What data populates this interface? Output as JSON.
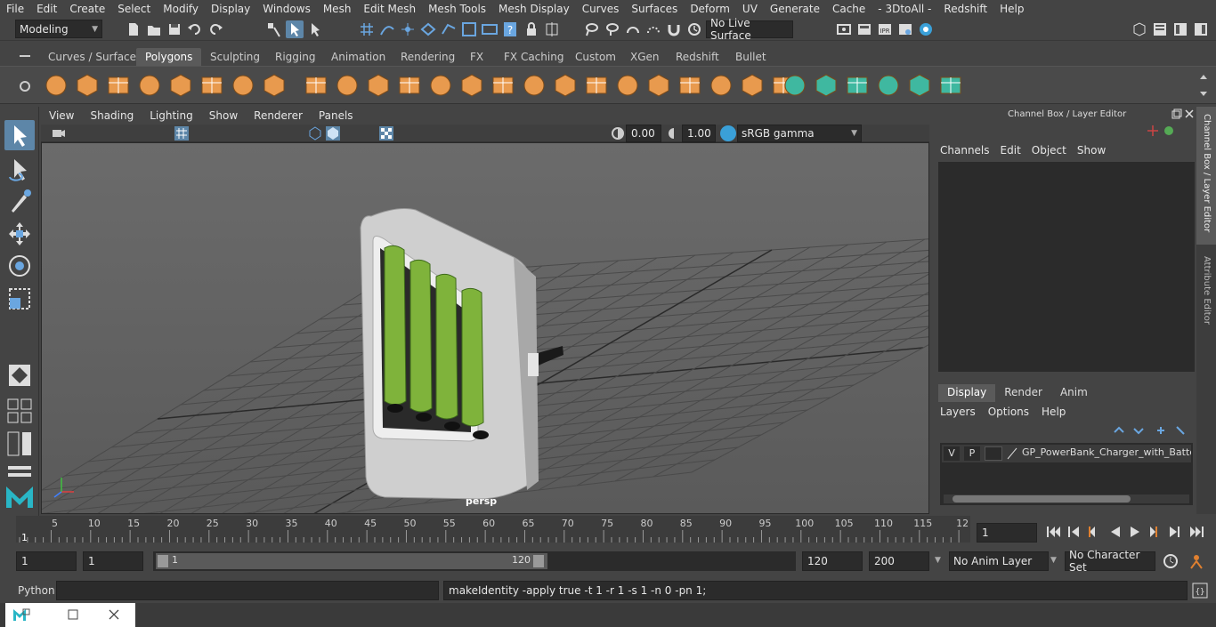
{
  "menubar": {
    "items": [
      "File",
      "Edit",
      "Create",
      "Select",
      "Modify",
      "Display",
      "Windows",
      "Mesh",
      "Edit Mesh",
      "Mesh Tools",
      "Mesh Display",
      "Curves",
      "Surfaces",
      "Deform",
      "UV",
      "Generate",
      "Cache",
      "- 3DtoAll -",
      "Redshift",
      "Help"
    ]
  },
  "statusline": {
    "mode": "Modeling",
    "live_surface": "No Live Surface"
  },
  "shelf": {
    "tabs": [
      "Curves / Surfaces",
      "Polygons",
      "Sculpting",
      "Rigging",
      "Animation",
      "Rendering",
      "FX",
      "FX Caching",
      "Custom",
      "XGen",
      "Redshift",
      "Bullet"
    ],
    "active_tab": "Polygons"
  },
  "panel": {
    "menus": [
      "View",
      "Shading",
      "Lighting",
      "Show",
      "Renderer",
      "Panels"
    ],
    "exposure": "0.00",
    "gamma": "1.00",
    "color_space": "sRGB gamma",
    "camera_label": "persp"
  },
  "channel_box": {
    "title": "Channel Box / Layer Editor",
    "menus": [
      "Channels",
      "Edit",
      "Object",
      "Show"
    ],
    "layer_tabs": [
      "Display",
      "Render",
      "Anim"
    ],
    "active_layer_tab": "Display",
    "layer_menus": [
      "Layers",
      "Options",
      "Help"
    ],
    "layer": {
      "v": "V",
      "p": "P",
      "name": "GP_PowerBank_Charger_with_Batteri"
    }
  },
  "side_tabs": [
    "Channel Box / Layer Editor",
    "Attribute Editor"
  ],
  "timeslider": {
    "ticks": [
      "5",
      "10",
      "15",
      "20",
      "25",
      "30",
      "35",
      "40",
      "45",
      "50",
      "55",
      "60",
      "65",
      "70",
      "75",
      "80",
      "85",
      "90",
      "95",
      "100",
      "105",
      "110",
      "115",
      "12"
    ],
    "current_frame_marker": "1",
    "current_frame": "1"
  },
  "range": {
    "start": "1",
    "playback_start": "1",
    "slider_start": "1",
    "slider_end": "120",
    "playback_end": "120",
    "end": "200",
    "anim_layer": "No Anim Layer",
    "character_set": "No Character Set"
  },
  "cmdline": {
    "language": "Python",
    "input": "",
    "result": "makeIdentity -apply true -t 1 -r 1 -s 1 -n 0 -pn 1;"
  },
  "colors": {
    "accent": "#5d86a8",
    "battery_green": "#7fb33b",
    "charger_white": "#d8d8d8"
  }
}
